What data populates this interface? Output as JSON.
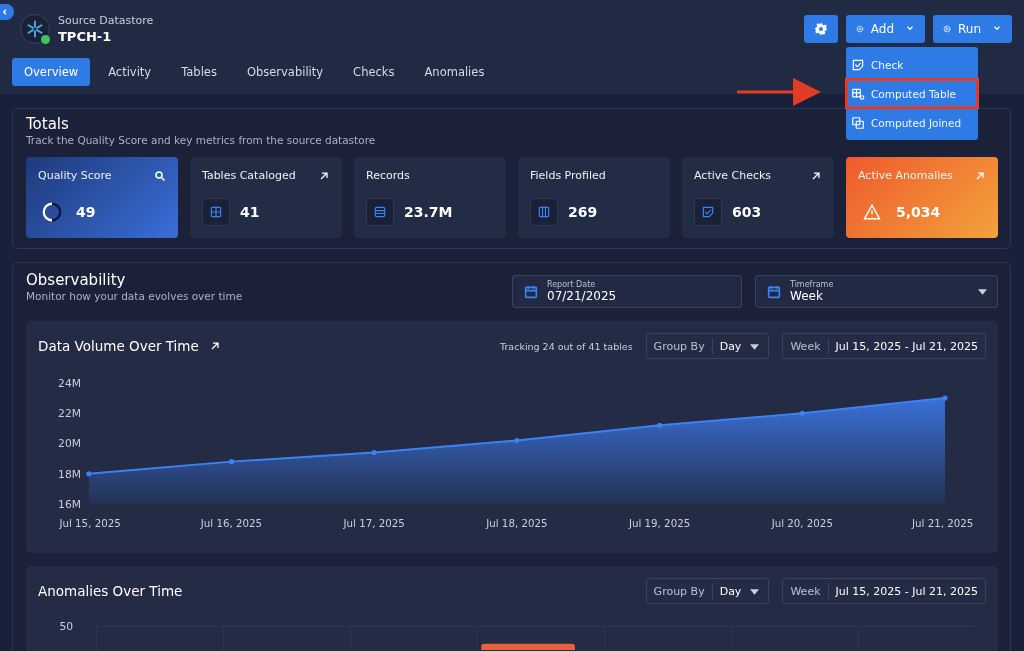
{
  "header": {
    "subtitle": "Source Datastore",
    "title": "TPCH-1",
    "status_online": true
  },
  "actions": {
    "add_label": "Add",
    "run_label": "Run"
  },
  "add_menu": [
    {
      "label": "Check",
      "highlighted": false
    },
    {
      "label": "Computed Table",
      "highlighted": true
    },
    {
      "label": "Computed Joined",
      "highlighted": false
    }
  ],
  "tabs": [
    {
      "label": "Overview",
      "selected": true
    },
    {
      "label": "Activity",
      "selected": false
    },
    {
      "label": "Tables",
      "selected": false
    },
    {
      "label": "Observability",
      "selected": false
    },
    {
      "label": "Checks",
      "selected": false
    },
    {
      "label": "Anomalies",
      "selected": false
    }
  ],
  "totals": {
    "title": "Totals",
    "subtitle": "Track the Quality Score and key metrics from the source datastore",
    "cards": [
      {
        "kind": "score",
        "label": "Quality Score",
        "value": "49"
      },
      {
        "kind": "table",
        "label": "Tables Cataloged",
        "value": "41"
      },
      {
        "kind": "records",
        "label": "Records",
        "value": "23.7M"
      },
      {
        "kind": "fields",
        "label": "Fields Profiled",
        "value": "269"
      },
      {
        "kind": "checks",
        "label": "Active Checks",
        "value": "603"
      },
      {
        "kind": "anomalies",
        "label": "Active Anomalies",
        "value": "5,034"
      }
    ]
  },
  "observability": {
    "title": "Observability",
    "subtitle": "Monitor how your data evolves over time",
    "report_date": {
      "label": "Report Date",
      "value": "07/21/2025"
    },
    "timeframe": {
      "label": "Timeframe",
      "value": "Week"
    }
  },
  "volume": {
    "title": "Data Volume Over Time",
    "tracking": "Tracking 24 out of 41 tables",
    "group_by_label": "Group By",
    "group_by": "Day",
    "range_label": "Week",
    "range": "Jul 15, 2025 - Jul 21, 2025",
    "chart_data": {
      "type": "area",
      "categories": [
        "Jul 15, 2025",
        "Jul 16, 2025",
        "Jul 17, 2025",
        "Jul 18, 2025",
        "Jul 19, 2025",
        "Jul 20, 2025",
        "Jul 21, 2025"
      ],
      "series": [
        {
          "color": "#3b82f6",
          "values": [
            18.0,
            18.8,
            19.4,
            20.2,
            21.2,
            22.0,
            23.0
          ]
        }
      ],
      "ylim": [
        16,
        24
      ],
      "yticks": [
        {
          "value": 16,
          "label": "16M"
        },
        {
          "value": 18,
          "label": "18M"
        },
        {
          "value": 20,
          "label": "20M"
        },
        {
          "value": 22,
          "label": "22M"
        },
        {
          "value": 24,
          "label": "24M"
        }
      ]
    }
  },
  "anomalies": {
    "title": "Anomalies Over Time",
    "group_by_label": "Group By",
    "group_by": "Day",
    "range_label": "Week",
    "range": "Jul 15, 2025 - Jul 21, 2025",
    "y_top_label": "50"
  }
}
